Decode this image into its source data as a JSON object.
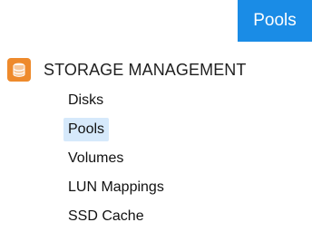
{
  "header": {
    "badge_label": "Pools"
  },
  "sidebar": {
    "section": {
      "title": "STORAGE MANAGEMENT",
      "icon": "storage-icon",
      "icon_color": "#ee8a2c"
    },
    "items": [
      {
        "label": "Disks",
        "active": false
      },
      {
        "label": "Pools",
        "active": true
      },
      {
        "label": "Volumes",
        "active": false
      },
      {
        "label": "LUN Mappings",
        "active": false
      },
      {
        "label": "SSD Cache",
        "active": false
      }
    ]
  },
  "colors": {
    "accent": "#1a8ce6",
    "selected_bg": "#d6e9fb"
  }
}
